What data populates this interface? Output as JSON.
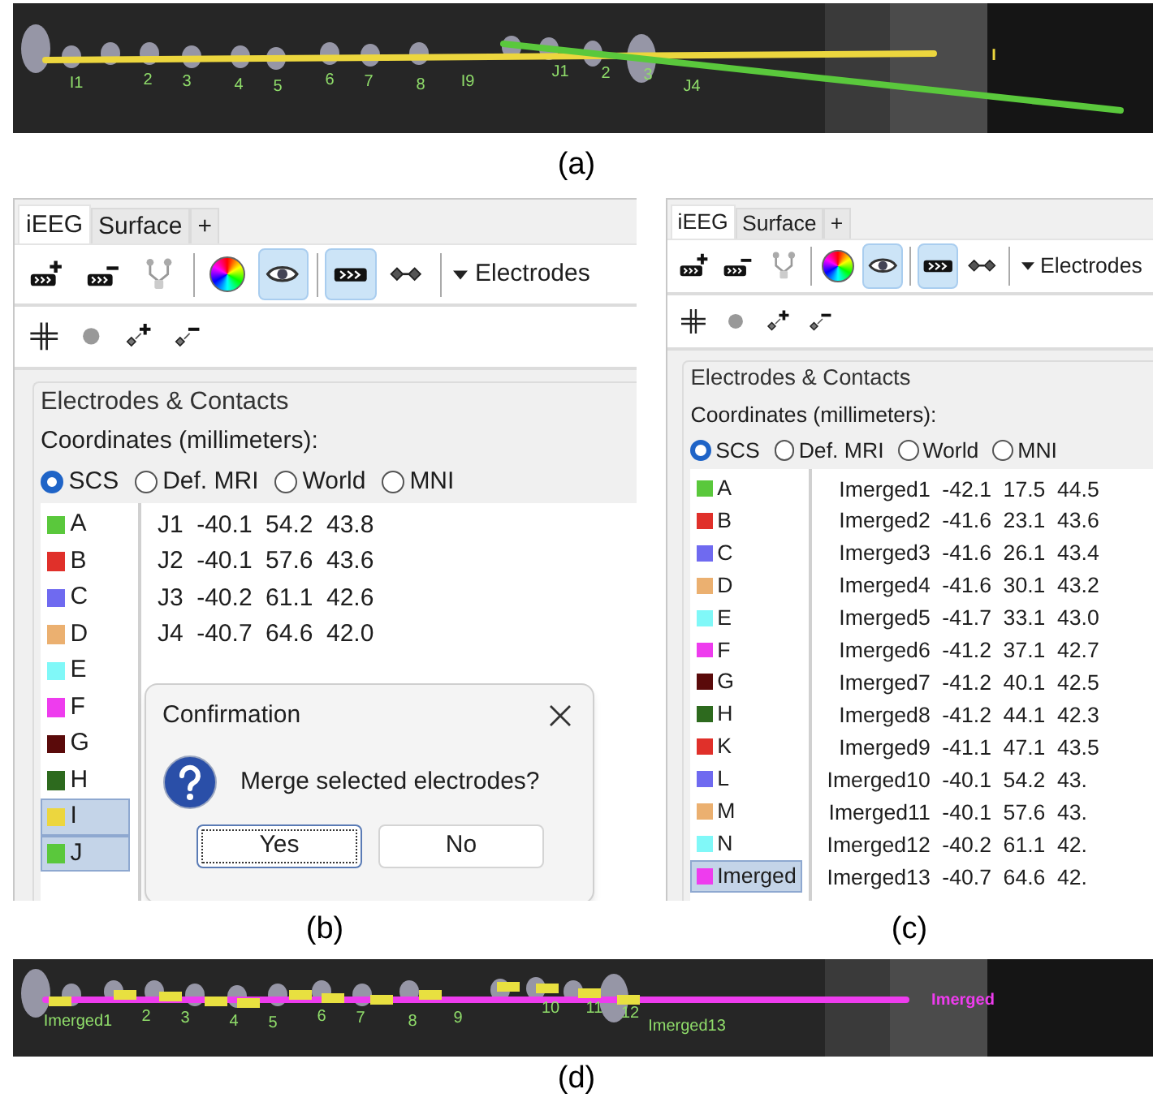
{
  "panel_a": {
    "caption": "(a)",
    "electrodes": [
      {
        "label": "I",
        "color": "#ecd63e",
        "contacts": [
          "I1",
          "2",
          "3",
          "4",
          "5",
          "6",
          "7",
          "8",
          "I9"
        ]
      },
      {
        "color": "#5ac83c",
        "contacts": [
          "J1",
          "2",
          "3",
          "J4"
        ]
      }
    ]
  },
  "panel_b": {
    "caption": "(b)",
    "tabs": [
      {
        "label": "iEEG",
        "selected": true
      },
      {
        "label": "Surface",
        "selected": false
      },
      {
        "label": "+",
        "selected": false
      }
    ],
    "toolbar": [
      {
        "kind": "add-electrode",
        "pressed": false
      },
      {
        "kind": "remove-electrode",
        "pressed": false
      },
      {
        "kind": "branch",
        "pressed": false
      },
      {
        "kind": "separator"
      },
      {
        "kind": "colors",
        "pressed": false
      },
      {
        "kind": "eye",
        "pressed": true
      },
      {
        "kind": "separator"
      },
      {
        "kind": "electrode",
        "pressed": true
      },
      {
        "kind": "contacts",
        "pressed": false
      },
      {
        "kind": "separator"
      },
      {
        "kind": "dropdown",
        "label": "Electrodes"
      }
    ],
    "toolbar_2": [
      {
        "kind": "crosshair"
      },
      {
        "kind": "dot"
      },
      {
        "kind": "add-contact"
      },
      {
        "kind": "remove-contact"
      }
    ],
    "group_title": "Electrodes & Contacts",
    "coordinates_label": "Coordinates (millimeters):",
    "coordinate_systems": [
      {
        "label": "SCS",
        "selected": true
      },
      {
        "label": "Def. MRI",
        "selected": false
      },
      {
        "label": "World",
        "selected": false
      },
      {
        "label": "MNI",
        "selected": false
      }
    ],
    "electrodes": [
      {
        "name": "A",
        "color": "#5ac83c",
        "selected": false
      },
      {
        "name": "B",
        "color": "#e0302a",
        "selected": false
      },
      {
        "name": "C",
        "color": "#6f6af0",
        "selected": false
      },
      {
        "name": "D",
        "color": "#ebb070",
        "selected": false
      },
      {
        "name": "E",
        "color": "#80f8f8",
        "selected": false
      },
      {
        "name": "F",
        "color": "#ee3cee",
        "selected": false
      },
      {
        "name": "G",
        "color": "#5a0a0a",
        "selected": false
      },
      {
        "name": "H",
        "color": "#2d6a1e",
        "selected": false
      },
      {
        "name": "I",
        "color": "#ecd63e",
        "selected": true
      },
      {
        "name": "J",
        "color": "#5ac83c",
        "selected": true
      }
    ],
    "contacts": [
      [
        "J1",
        "-40.1",
        "54.2",
        "43.8"
      ],
      [
        "J2",
        "-40.1",
        "57.6",
        "43.6"
      ],
      [
        "J3",
        "-40.2",
        "61.1",
        "42.6"
      ],
      [
        "J4",
        "-40.7",
        "64.6",
        "42.0"
      ]
    ],
    "dialog": {
      "title": "Confirmation",
      "message": "Merge selected electrodes?",
      "buttons": [
        {
          "label": "Yes",
          "focused": true
        },
        {
          "label": "No",
          "focused": false
        }
      ]
    }
  },
  "panel_c": {
    "caption": "(c)",
    "tabs": [
      {
        "label": "iEEG",
        "selected": true
      },
      {
        "label": "Surface",
        "selected": false
      },
      {
        "label": "+",
        "selected": false
      }
    ],
    "toolbar": [
      {
        "kind": "add-electrode",
        "pressed": false
      },
      {
        "kind": "remove-electrode",
        "pressed": false
      },
      {
        "kind": "branch",
        "pressed": false
      },
      {
        "kind": "separator"
      },
      {
        "kind": "colors",
        "pressed": false
      },
      {
        "kind": "eye",
        "pressed": true
      },
      {
        "kind": "separator"
      },
      {
        "kind": "electrode",
        "pressed": true
      },
      {
        "kind": "contacts",
        "pressed": false
      },
      {
        "kind": "separator"
      },
      {
        "kind": "dropdown",
        "label": "Electrodes"
      }
    ],
    "toolbar_2": [
      {
        "kind": "crosshair"
      },
      {
        "kind": "dot"
      },
      {
        "kind": "add-contact"
      },
      {
        "kind": "remove-contact"
      }
    ],
    "group_title": "Electrodes & Contacts",
    "coordinates_label": "Coordinates (millimeters):",
    "coordinate_systems": [
      {
        "label": "SCS",
        "selected": true
      },
      {
        "label": "Def. MRI",
        "selected": false
      },
      {
        "label": "World",
        "selected": false
      },
      {
        "label": "MNI",
        "selected": false
      }
    ],
    "electrodes": [
      {
        "name": "A",
        "color": "#5ac83c",
        "selected": false
      },
      {
        "name": "B",
        "color": "#e0302a",
        "selected": false
      },
      {
        "name": "C",
        "color": "#6f6af0",
        "selected": false
      },
      {
        "name": "D",
        "color": "#ebb070",
        "selected": false
      },
      {
        "name": "E",
        "color": "#80f8f8",
        "selected": false
      },
      {
        "name": "F",
        "color": "#ee3cee",
        "selected": false
      },
      {
        "name": "G",
        "color": "#5a0a0a",
        "selected": false
      },
      {
        "name": "H",
        "color": "#2d6a1e",
        "selected": false
      },
      {
        "name": "K",
        "color": "#e0302a",
        "selected": false
      },
      {
        "name": "L",
        "color": "#6f6af0",
        "selected": false
      },
      {
        "name": "M",
        "color": "#ebb070",
        "selected": false
      },
      {
        "name": "N",
        "color": "#80f8f8",
        "selected": false
      },
      {
        "name": "Imerged",
        "color": "#ee3cee",
        "selected": true
      }
    ],
    "contacts": [
      [
        "Imerged1",
        "-42.1",
        "17.5",
        "44.5"
      ],
      [
        "Imerged2",
        "-41.6",
        "23.1",
        "43.6"
      ],
      [
        "Imerged3",
        "-41.6",
        "26.1",
        "43.4"
      ],
      [
        "Imerged4",
        "-41.6",
        "30.1",
        "43.2"
      ],
      [
        "Imerged5",
        "-41.7",
        "33.1",
        "43.0"
      ],
      [
        "Imerged6",
        "-41.2",
        "37.1",
        "42.7"
      ],
      [
        "Imerged7",
        "-41.2",
        "40.1",
        "42.5"
      ],
      [
        "Imerged8",
        "-41.2",
        "44.1",
        "42.3"
      ],
      [
        "Imerged9",
        "-41.1",
        "47.1",
        "43.5"
      ],
      [
        "Imerged10",
        "-40.1",
        "54.2",
        "43."
      ],
      [
        "Imerged11",
        "-40.1",
        "57.6",
        "43."
      ],
      [
        "Imerged12",
        "-40.2",
        "61.1",
        "42."
      ],
      [
        "Imerged13",
        "-40.7",
        "64.6",
        "42."
      ]
    ]
  },
  "panel_d": {
    "caption": "(d)",
    "electrodes": [
      {
        "label": "Imerged",
        "color": "#ee3cee",
        "contacts": [
          "Imerged1",
          "2",
          "3",
          "4",
          "5",
          "6",
          "7",
          "8",
          "9",
          "10",
          "11",
          "12",
          "Imerged13"
        ]
      }
    ]
  }
}
